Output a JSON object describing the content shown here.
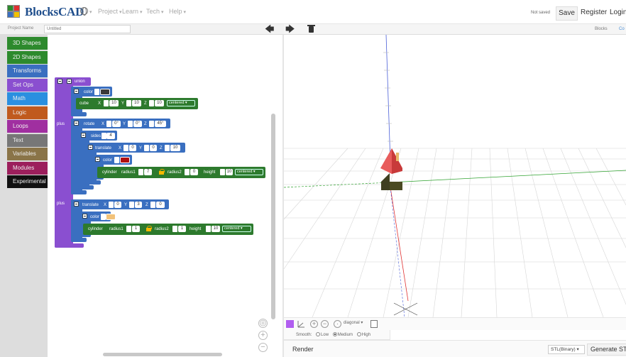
{
  "app": {
    "brand": "BlocksCAD",
    "save_status": "Not saved"
  },
  "nav": {
    "menus": [
      "Project",
      "Learn",
      "Tech",
      "Help"
    ],
    "save_label": "Save",
    "register_label": "Register",
    "login_label": "Login"
  },
  "project": {
    "name_label": "Project Name",
    "name_value": "Untitled"
  },
  "views": {
    "blocks_tab": "Blocks",
    "code_tab": "Co"
  },
  "categories": [
    {
      "label": "3D Shapes",
      "color": "#2d8a2d"
    },
    {
      "label": "2D Shapes",
      "color": "#2d8a2d"
    },
    {
      "label": "Transforms",
      "color": "#3a6fc0"
    },
    {
      "label": "Set Ops",
      "color": "#8a4fd0"
    },
    {
      "label": "Math",
      "color": "#2a8fe0"
    },
    {
      "label": "Logic",
      "color": "#c05a1e"
    },
    {
      "label": "Loops",
      "color": "#a02fa0"
    },
    {
      "label": "Text",
      "color": "#777777"
    },
    {
      "label": "Variables",
      "color": "#8a7448"
    },
    {
      "label": "Modules",
      "color": "#9c1f5c"
    },
    {
      "label": "Experimental",
      "color": "#111111"
    }
  ],
  "blocks": {
    "union": "union",
    "plus": "plus",
    "color": "color",
    "cube": "cube",
    "x": "X",
    "y": "Y",
    "z": "Z",
    "cube_x": "10",
    "cube_y": "10",
    "cube_z": "10",
    "centered": "centered",
    "rotate": "rotate",
    "rot_x": "0°",
    "rot_y": "0°",
    "rot_z": "45°",
    "sides": "sides",
    "sides_value": "4",
    "translate": "translate",
    "tr1_x": "0",
    "tr1_y": "0",
    "tr1_z": "10",
    "cylinder": "cylinder",
    "radius1": "radius1",
    "radius2": "radius2",
    "height": "height",
    "cyl1_r1": "7",
    "cyl1_r2": "0",
    "cyl1_h": "10",
    "tr2_x": "0",
    "tr2_y": "3",
    "tr2_z": "0",
    "cyl2_r1": "1",
    "cyl2_r2": "1",
    "cyl2_h": "10",
    "swatch_cube": "#3a3a3a",
    "swatch_roof": "#b01010",
    "swatch_chimney": "#f2c27a"
  },
  "viewer": {
    "view_select": "diagonal",
    "smooth_label": "Smooth:",
    "smooth_options": [
      "Low",
      "Medium",
      "High"
    ],
    "smooth_selected": "Medium",
    "object_color": "#b15ef0",
    "render_label": "Render",
    "format_label": "STL(Binary)",
    "generate_label": "Generate STL"
  },
  "icons": [
    "undo-icon",
    "redo-icon",
    "trash-icon",
    "globe-icon",
    "zoom-in-icon",
    "zoom-out-icon",
    "zoom-reset-icon",
    "camera-icon",
    "lock-icon"
  ]
}
